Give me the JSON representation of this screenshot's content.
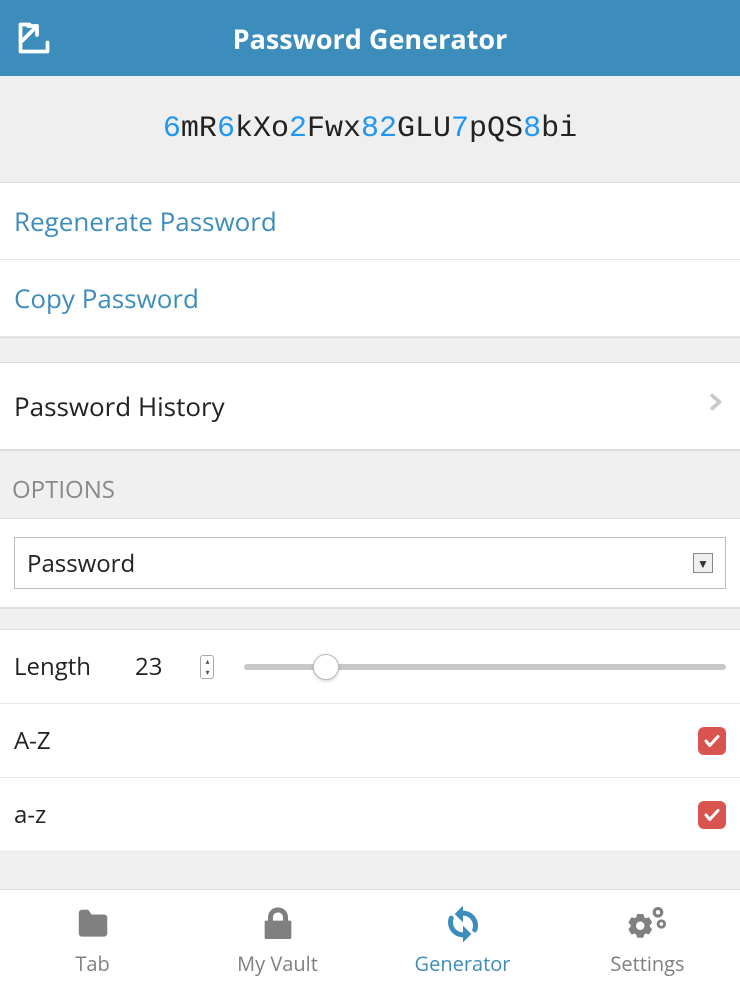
{
  "header": {
    "title": "Password Generator"
  },
  "password": {
    "segments": [
      {
        "t": "6",
        "c": "digit"
      },
      {
        "t": "mR",
        "c": "letter"
      },
      {
        "t": "6",
        "c": "digit"
      },
      {
        "t": "kXo",
        "c": "letter"
      },
      {
        "t": "2",
        "c": "digit"
      },
      {
        "t": "Fwx",
        "c": "letter"
      },
      {
        "t": "82",
        "c": "digit"
      },
      {
        "t": "GLU",
        "c": "letter"
      },
      {
        "t": "7",
        "c": "digit"
      },
      {
        "t": "pQS",
        "c": "letter"
      },
      {
        "t": "8",
        "c": "digit"
      },
      {
        "t": "bi",
        "c": "letter"
      }
    ]
  },
  "actions": {
    "regenerate": "Regenerate Password",
    "copy": "Copy Password",
    "history": "Password History"
  },
  "options": {
    "header": "OPTIONS",
    "type_select": "Password",
    "length_label": "Length",
    "length_value": "23",
    "uppercase_label": "A-Z",
    "uppercase_checked": true,
    "lowercase_label": "a-z",
    "lowercase_checked": true
  },
  "tabbar": {
    "items": [
      {
        "label": "Tab",
        "icon": "folder-icon",
        "active": false
      },
      {
        "label": "My Vault",
        "icon": "lock-icon",
        "active": false
      },
      {
        "label": "Generator",
        "icon": "refresh-icon",
        "active": true
      },
      {
        "label": "Settings",
        "icon": "gears-icon",
        "active": false
      }
    ]
  }
}
